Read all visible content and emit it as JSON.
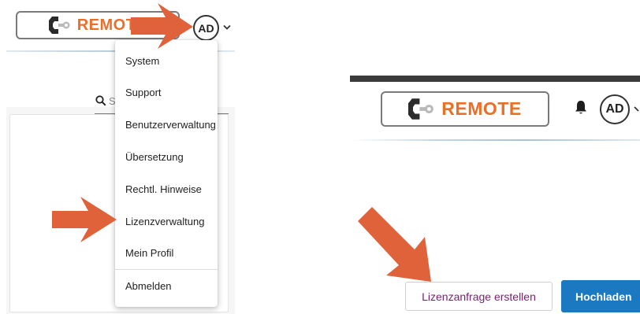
{
  "left_panel": {
    "logo_text": "REMOTE",
    "avatar_initials": "AD",
    "search_placeholder": "S",
    "menu_items": [
      {
        "label": "System"
      },
      {
        "label": "Support"
      },
      {
        "label": "Benutzerverwaltung"
      },
      {
        "label": "Übersetzung"
      },
      {
        "label": "Rechtl. Hinweise"
      },
      {
        "label": "Lizenzverwaltung"
      },
      {
        "label": "Mein Profil"
      },
      {
        "label": "Abmelden"
      }
    ]
  },
  "right_panel": {
    "logo_text": "REMOTE",
    "avatar_initials": "AD",
    "secondary_button": "Lizenzanfrage erstellen",
    "primary_button": "Hochladen"
  },
  "colors": {
    "annotation_arrow": "#e0623a",
    "brand_orange": "#e8702a",
    "primary_button": "#1b79c2",
    "secondary_button_text": "#7b1f6e"
  },
  "icons": [
    "remote-logo-icon",
    "avatar",
    "chevron-down-icon",
    "search-icon",
    "bell-icon",
    "annotation-arrow"
  ]
}
